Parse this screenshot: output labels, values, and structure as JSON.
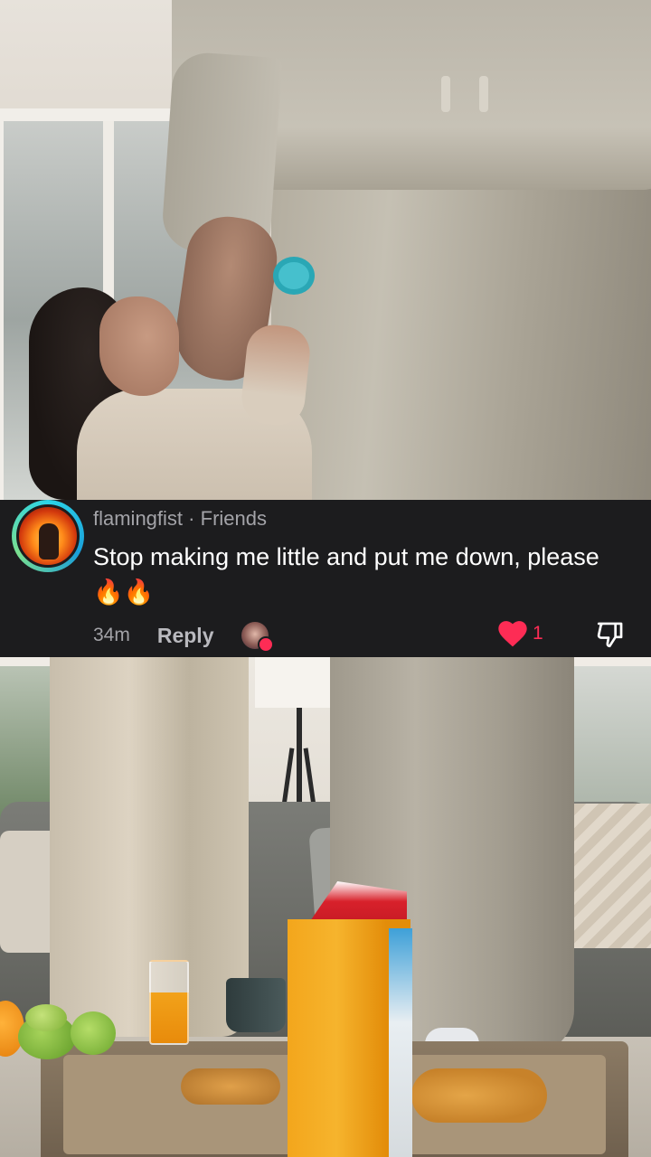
{
  "comment": {
    "username": "flamingfist",
    "relation": "Friends",
    "separator": "·",
    "text": "Stop making me little and put me down, please 🔥🔥",
    "time": "34m",
    "reply_label": "Reply",
    "like_count": "1",
    "liked": true
  },
  "icons": {
    "like": "heart-icon",
    "dislike": "thumbs-down-icon",
    "avatar": "user-avatar",
    "creator_liked": "creator-liked-avatar"
  },
  "colors": {
    "background": "#1c1c1e",
    "like_active": "#fe2c55",
    "secondary_text": "#a3a3a8"
  }
}
